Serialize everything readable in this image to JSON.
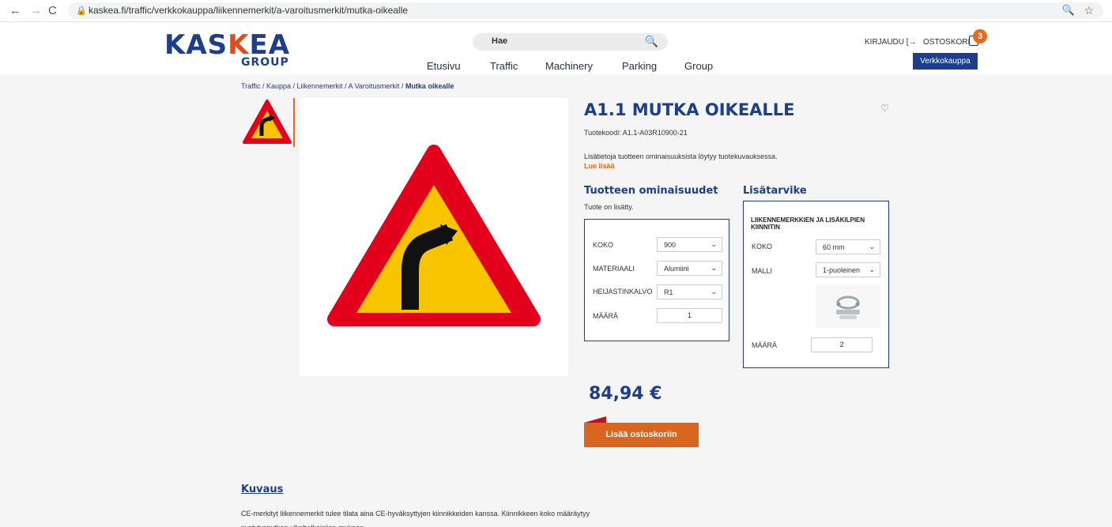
{
  "browser": {
    "url": "kaskea.fi/traffic/verkkokauppa/liikennemerkit/a-varoitusmerkit/mutka-oikealle",
    "back_glyph": "←",
    "forward_glyph": "→",
    "reload_glyph": "C",
    "lock_glyph": "🔒",
    "zoom_glyph": "🔍",
    "star_glyph": "☆"
  },
  "header": {
    "logo_main_a": "KAS",
    "logo_main_k": "K",
    "logo_main_b": "EA",
    "logo_sub": "GROUP",
    "search_placeholder": "Hae",
    "search_glyph": "🔍",
    "menu": [
      "Etusivu",
      "Traffic",
      "Machinery",
      "Parking",
      "Group"
    ],
    "login": "KIRJAUDU [→",
    "cart": "OSTOSKORI",
    "cart_count": "3",
    "shop_button": "Verkkokauppa"
  },
  "breadcrumb": {
    "path": "Traffic / Kauppa / Liikennemerkit / A Varoitusmerkit / ",
    "current": "Mutka oikealle"
  },
  "product": {
    "title": "A1.1 MUTKA OIKEALLE",
    "heart_glyph": "♡",
    "code": "Tuotekoodi: A1.1-A03R10900-21",
    "info": "Lisätietoja tuotteen ominaisuuksista löytyy tuotekuvauksessa.",
    "read_more": "Lue lisää",
    "props_heading": "Tuotteen ominaisuudet",
    "added_note": "Tuote on lisätty.",
    "props": {
      "size_label": "KOKO",
      "size_value": "900",
      "material_label": "MATERIAALI",
      "material_value": "Alumiini",
      "reflector_label": "HEIJASTINKALVO",
      "reflector_value": "R1",
      "qty_label": "MÄÄRÄ",
      "qty_value": "1"
    },
    "accessory_heading": "Lisätarvike",
    "accessory": {
      "title": "LIIKENNEMERKKIEN JA LISÄKILPIEN KIINNITIN",
      "size_label": "KOKO",
      "size_value": "60 mm",
      "model_label": "MALLI",
      "model_value": "1-puoleinen",
      "qty_label": "MÄÄRÄ",
      "qty_value": "2"
    },
    "price": "84,94 €",
    "add_to_cart": "Lisää ostoskoriin"
  },
  "description": {
    "heading": "Kuvaus",
    "text": "CE-merkityt liikennemerkit tulee tilata aina CE-hyväksyttyjen kiinnikkeiden kanssa. Kiinnikkeen koko määräytyy pystytysputken ulkohalkaisijan mukaan."
  },
  "colors": {
    "brand_blue": "#1c3e8c",
    "accent_orange": "#e36b1d",
    "sign_red": "#e3001b",
    "sign_yellow": "#f8c400"
  },
  "chevron_glyph": "⌄"
}
